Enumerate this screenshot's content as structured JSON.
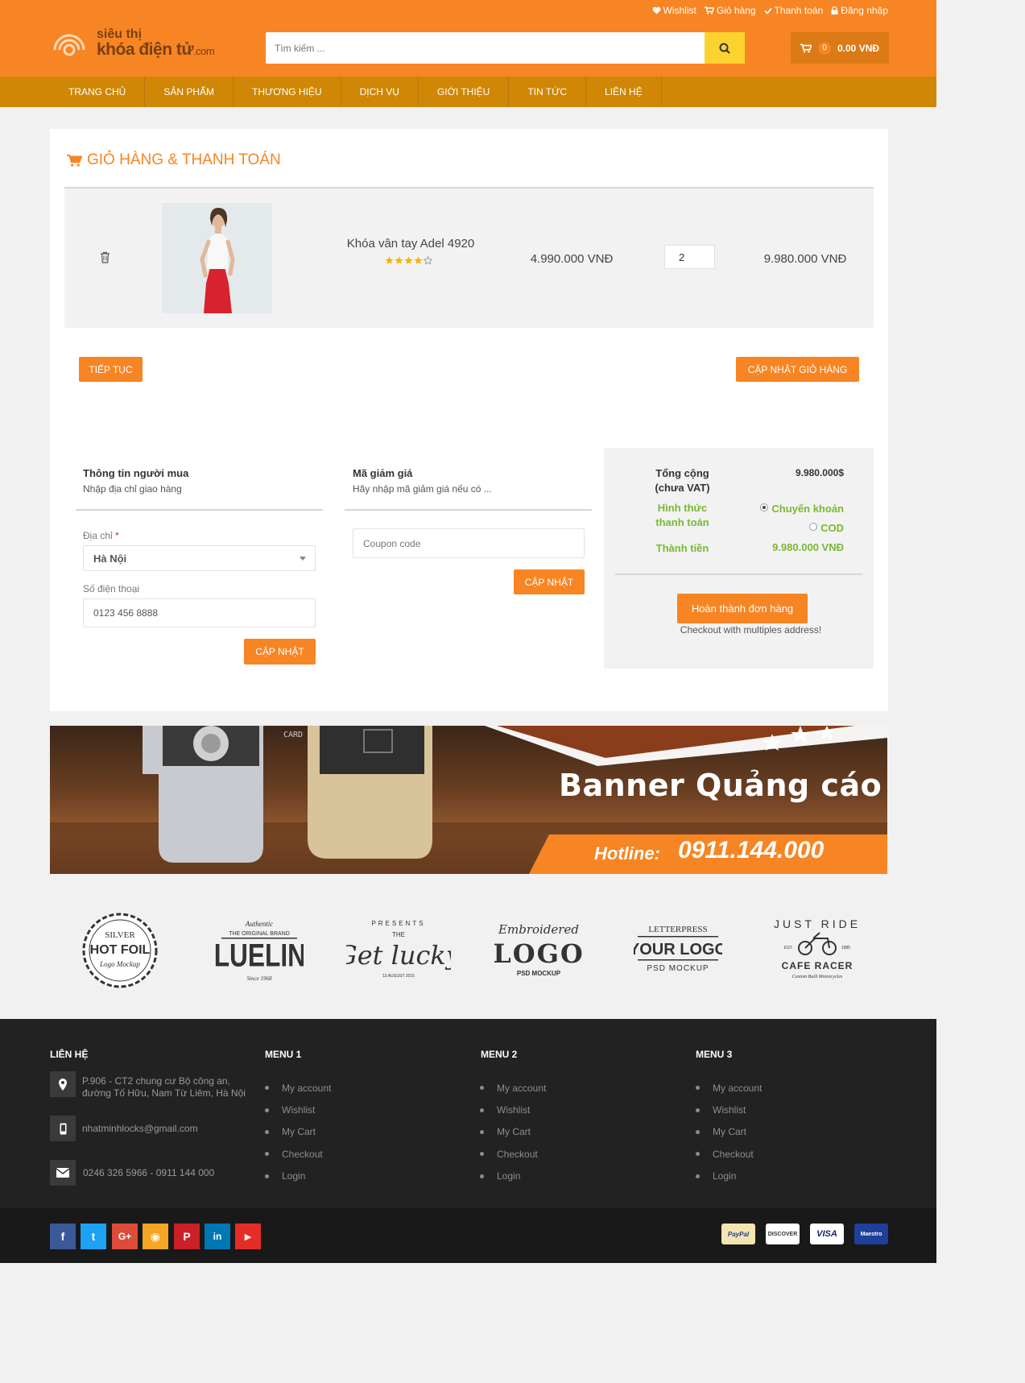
{
  "header": {
    "top_links": [
      {
        "icon": "heart-icon",
        "label": "Wishlist"
      },
      {
        "icon": "cart-icon",
        "label": "Giỏ hàng"
      },
      {
        "icon": "check-icon",
        "label": "Thanh toán"
      },
      {
        "icon": "lock-icon",
        "label": "Đăng nhập"
      }
    ],
    "logo_line1": "siêu thị",
    "logo_line2": "khóa điện tử",
    "logo_suffix": ".com",
    "search_placeholder": "Tìm kiếm ...",
    "cart_count": "0",
    "cart_total": "0.00 VNĐ"
  },
  "nav": [
    "TRANG CHỦ",
    "SẢN PHẨM",
    "THƯƠNG HIỆU",
    "DỊCH VỤ",
    "GIỚI THIỆU",
    "TIN TỨC",
    "LIÊN HỆ"
  ],
  "cart": {
    "title": "GIỎ HÀNG & THANH TOÁN",
    "item": {
      "name": "Khóa vân tay Adel 4920",
      "rating": 4,
      "rating_max": 5,
      "price": "4.990.000 VNĐ",
      "quantity": "2",
      "subtotal": "9.980.000 VNĐ"
    },
    "continue_label": "TIẾP TỤC",
    "update_cart_label": "CẬP NHẬT GIỎ HÀNG"
  },
  "buyer": {
    "heading": "Thông tin người mua",
    "sub": "Nhập địa chỉ giao hàng",
    "address_label": "Địa chỉ",
    "required_mark": "*",
    "address_value": "Hà Nội",
    "phone_label": "Số điện thoại",
    "phone_value": "0123 456 8888",
    "update_label": "CẬP NHẬT"
  },
  "coupon": {
    "heading": "Mã giảm giá",
    "sub": "Hãy nhập mã giảm giá nếu có ...",
    "placeholder": "Coupon code",
    "update_label": "CẬP NHẬT"
  },
  "summary": {
    "total_label_1": "Tổng cộng",
    "total_label_2": "(chưa VAT)",
    "total_value": "9.980.000$",
    "payment_label_1": "Hình thức",
    "payment_label_2": "thanh toán",
    "payment_options": [
      "Chuyển khoản",
      "COD"
    ],
    "payment_selected": "Chuyển khoản",
    "grand_label": "Thành tiền",
    "grand_value": "9.980.000 VNĐ",
    "checkout_label": "Hoàn thành đơn hàng",
    "checkout_note": "Checkout with multiples address!"
  },
  "banner": {
    "title": "Banner Quảng cáo",
    "hotline_label": "Hotline:",
    "hotline_number": "0911.144.000",
    "card_text": "CARD"
  },
  "brands": [
    {
      "lines": [
        "SILVER",
        "HOT FOIL",
        "Logo Mockup"
      ]
    },
    {
      "lines": [
        "Authentic",
        "THE ORIGINAL BRAND",
        "BLUELINE",
        "Since 1968"
      ]
    },
    {
      "lines": [
        "PRESENTS",
        "THE",
        "Get lucky",
        "13 AUGUST 2015"
      ]
    },
    {
      "lines": [
        "Embroidered",
        "LOGO",
        "PSD MOCKUP"
      ]
    },
    {
      "lines": [
        "LETTERPRESS",
        "YOUR LOGO",
        "PSD MOCKUP"
      ]
    },
    {
      "lines": [
        "JUST RIDE",
        "EST.",
        "1985",
        "CAFE RACER",
        "Custom Built Motorcycles"
      ]
    }
  ],
  "footer": {
    "contact_heading": "LIÊN HỆ",
    "address_line1": "P.906 - CT2 chung cư Bộ công an,",
    "address_line2": "đường Tố Hữu, Nam Từ Liêm, Hà Nội",
    "email": "nhatminhlocks@gmail.com",
    "phone": "0246 326 5966 - 0911 144 000",
    "menus": [
      {
        "heading": "MENU 1",
        "items": [
          "My account",
          "Wishlist",
          "My Cart",
          "Checkout",
          "Login"
        ]
      },
      {
        "heading": "MENU 2",
        "items": [
          "My account",
          "Wishlist",
          "My Cart",
          "Checkout",
          "Login"
        ]
      },
      {
        "heading": "MENU 3",
        "items": [
          "My account",
          "Wishlist",
          "My Cart",
          "Checkout",
          "Login"
        ]
      }
    ]
  },
  "social": [
    {
      "name": "facebook-icon",
      "glyph": "f",
      "color": "#3b5998"
    },
    {
      "name": "twitter-icon",
      "glyph": "t",
      "color": "#1da1f2"
    },
    {
      "name": "google-plus-icon",
      "glyph": "G+",
      "color": "#dd4b39"
    },
    {
      "name": "rss-icon",
      "glyph": "◉",
      "color": "#f5a623"
    },
    {
      "name": "pinterest-icon",
      "glyph": "P",
      "color": "#cb2027"
    },
    {
      "name": "linkedin-icon",
      "glyph": "in",
      "color": "#0077b5"
    },
    {
      "name": "youtube-icon",
      "glyph": "▶",
      "color": "#e52d27"
    }
  ],
  "payments": [
    {
      "name": "paypal-logo",
      "label": "PayPal"
    },
    {
      "name": "discover-logo",
      "label": "DISCOVER"
    },
    {
      "name": "visa-logo",
      "label": "VISA"
    },
    {
      "name": "maestro-logo",
      "label": "Maestro"
    }
  ],
  "colors": {
    "brand": "#f78523",
    "nav": "#cf8705",
    "search_button": "#fcd32e",
    "accent_green": "#7ab833",
    "footer": "#222222"
  }
}
